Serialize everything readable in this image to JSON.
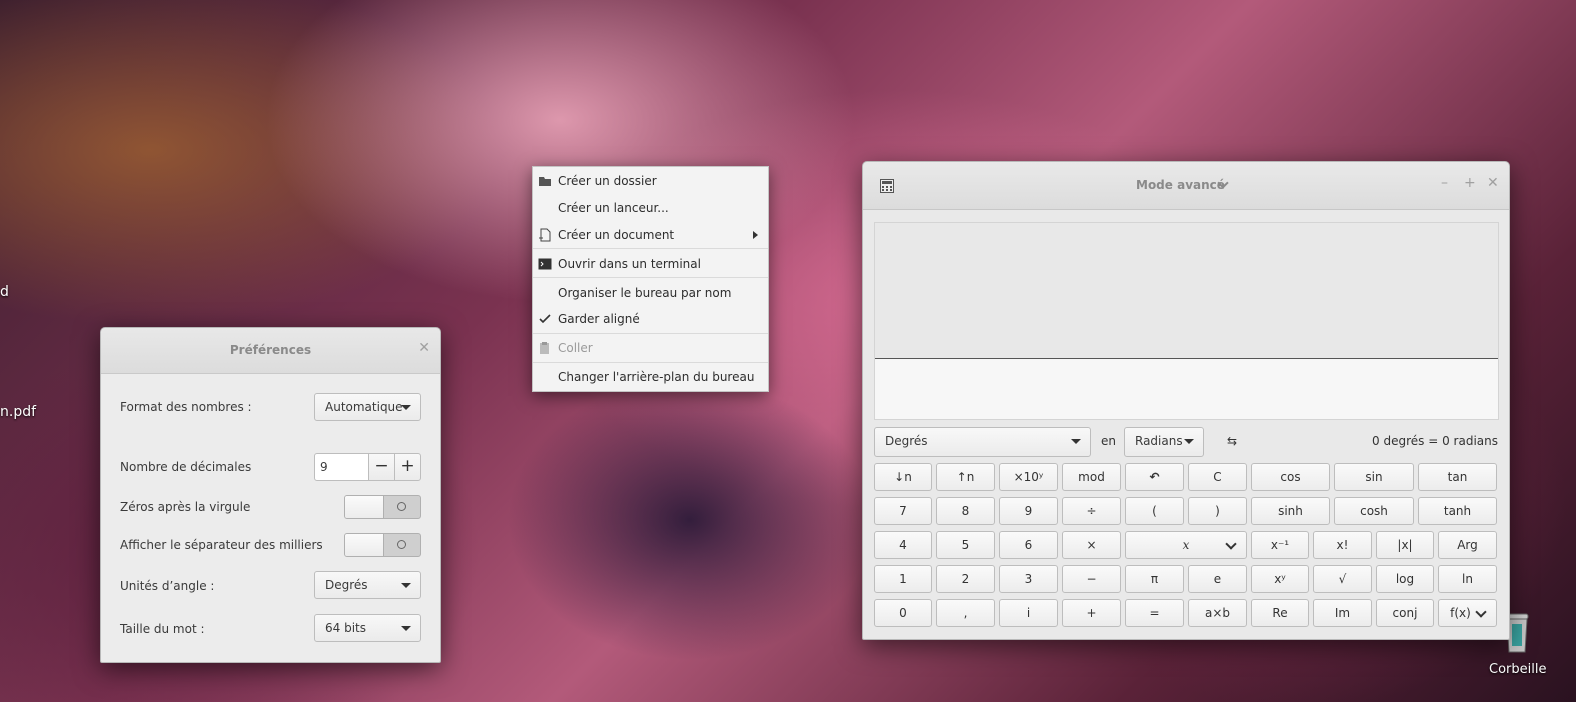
{
  "desktop": {
    "left_labels": [
      "d",
      "n.pdf"
    ],
    "trash_label": "Corbeille"
  },
  "prefs": {
    "title": "Préférences",
    "number_format_label": "Format des nombres :",
    "number_format_value": "Automatique",
    "decimals_label": "Nombre de décimales",
    "decimals_value": "9",
    "decrement": "−",
    "increment": "+",
    "trailing_zeros_label": "Zéros après la virgule",
    "thousands_label": "Afficher le séparateur des milliers",
    "angle_units_label": "Unités d’angle :",
    "angle_units_value": "Degrés",
    "word_size_label": "Taille du mot :",
    "word_size_value": "64 bits"
  },
  "context_menu": {
    "items": [
      {
        "label": "Créer un dossier",
        "icon": "folder-new-icon"
      },
      {
        "label": "Créer un lanceur..."
      },
      {
        "label": "Créer un document",
        "icon": "document-new-icon",
        "submenu": true
      },
      {
        "label": "Ouvrir dans un terminal",
        "icon": "terminal-icon"
      },
      {
        "label": "Organiser le bureau par nom"
      },
      {
        "label": "Garder aligné",
        "checked": true
      },
      {
        "label": "Coller",
        "icon": "paste-icon",
        "disabled": true
      },
      {
        "label": "Changer l'arrière-plan du bureau"
      }
    ]
  },
  "calculator": {
    "mode_title": "Mode avancé",
    "convert_from": "Degrés",
    "convert_in": "en",
    "convert_to": "Radians",
    "conversion_result": "0 degrés  =  0 radians",
    "rows": [
      [
        "↓n",
        "↑n",
        "×10ʸ",
        "mod",
        "↶",
        "C",
        "cos",
        "sin",
        "tan"
      ],
      [
        "7",
        "8",
        "9",
        "÷",
        "(",
        ")",
        "sinh",
        "cosh",
        "tanh"
      ],
      [
        "4",
        "5",
        "6",
        "×",
        "x",
        "x⁻¹",
        "x!",
        "|x|",
        "Arg"
      ],
      [
        "1",
        "2",
        "3",
        "−",
        "π",
        "e",
        "xʸ",
        "√",
        "log",
        "ln"
      ],
      [
        "0",
        ",",
        "i",
        "+",
        "=",
        "a×b",
        "Re",
        "Im",
        "conj",
        "f(x)"
      ]
    ]
  },
  "colors": {
    "accent": "#4a90d9",
    "window_bg": "#ececec",
    "title_text": "#8a8a8a"
  }
}
